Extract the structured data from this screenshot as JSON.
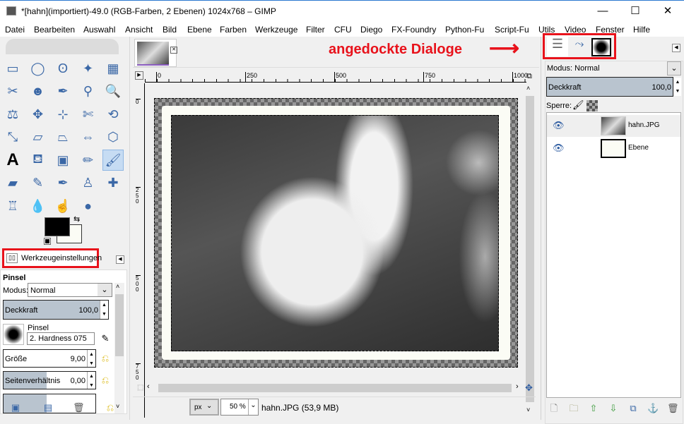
{
  "window": {
    "title": "*[hahn](importiert)-49.0 (RGB-Farben, 2 Ebenen) 1024x768 – GIMP",
    "minimize": "—",
    "maximize": "☐",
    "close": "✕"
  },
  "menu": [
    "Datei",
    "Bearbeiten",
    "Auswahl",
    "Ansicht",
    "Bild",
    "Ebene",
    "Farben",
    "Werkzeuge",
    "Filter",
    "CFU",
    "Diego",
    "FX-Foundry",
    "Python-Fu",
    "Script-Fu",
    "Utils",
    "Video",
    "Fenster",
    "Hilfe"
  ],
  "tools": [
    {
      "name": "rect-select",
      "g": "▭"
    },
    {
      "name": "ellipse-select",
      "g": "◯"
    },
    {
      "name": "free-select",
      "g": "ʘ"
    },
    {
      "name": "fuzzy-select",
      "g": "✦"
    },
    {
      "name": "select-by-color",
      "g": "▦"
    },
    {
      "name": "scissors",
      "g": "✂"
    },
    {
      "name": "foreground-select",
      "g": "☻"
    },
    {
      "name": "paths",
      "g": "✒"
    },
    {
      "name": "color-picker",
      "g": "⚲"
    },
    {
      "name": "zoom",
      "g": "🔍"
    },
    {
      "name": "measure",
      "g": "⚖"
    },
    {
      "name": "move",
      "g": "✥"
    },
    {
      "name": "align",
      "g": "⊹"
    },
    {
      "name": "crop",
      "g": "✄"
    },
    {
      "name": "rotate",
      "g": "⟲"
    },
    {
      "name": "scale",
      "g": "⤡"
    },
    {
      "name": "shear",
      "g": "▱"
    },
    {
      "name": "perspective",
      "g": "⏢"
    },
    {
      "name": "flip",
      "g": "⇔"
    },
    {
      "name": "cage-transform",
      "g": "⬡"
    },
    {
      "name": "text",
      "g": "A"
    },
    {
      "name": "bucket-fill",
      "g": "⛾"
    },
    {
      "name": "blend",
      "g": "▣"
    },
    {
      "name": "pencil",
      "g": "✏"
    },
    {
      "name": "paintbrush",
      "g": "🖌"
    },
    {
      "name": "eraser",
      "g": "▰"
    },
    {
      "name": "airbrush",
      "g": "✎"
    },
    {
      "name": "ink",
      "g": "✒"
    },
    {
      "name": "clone",
      "g": "♙"
    },
    {
      "name": "heal",
      "g": "✚"
    },
    {
      "name": "perspective-clone",
      "g": "♖"
    },
    {
      "name": "blur",
      "g": "💧"
    },
    {
      "name": "smudge",
      "g": "☝"
    },
    {
      "name": "dodge-burn",
      "g": "●"
    }
  ],
  "colors": {
    "foreground": "#000000",
    "background": "#fbfcf5",
    "accent_red": "#e8121b",
    "slider": "#b9c4cf"
  },
  "tool_options": {
    "tab_label": "Werkzeugeinstellungen",
    "tool_name": "Pinsel",
    "mode_label": "Modus:",
    "mode_value": "Normal",
    "opacity_label": "Deckkraft",
    "opacity_value": "100,0",
    "brush_label": "Pinsel",
    "brush_value": "2. Hardness 075",
    "size_label": "Größe",
    "size_value": "9,00",
    "aspect_label": "Seitenverhältnis",
    "aspect_value": "0,00"
  },
  "image_window": {
    "tab_thumb": "hahn",
    "ruler_h": [
      "0",
      "250",
      "500",
      "750",
      "1000"
    ],
    "ruler_v": [
      "0",
      "250",
      "500",
      "750"
    ],
    "unit": "px",
    "zoom": "50 %",
    "status": "hahn.JPG (53,9 MB)"
  },
  "annotation": {
    "text": "angedockte Dialoge",
    "arrow": "⟶"
  },
  "dock": {
    "tabs": [
      "layers-icon",
      "paths-icon",
      "brushes-icon"
    ],
    "mode_label": "Modus:",
    "mode_value": "Normal",
    "opacity_label": "Deckkraft",
    "opacity_value": "100,0",
    "lock_label": "Sperre:",
    "layers": [
      {
        "name": "hahn.JPG",
        "visible": true,
        "selected": true
      },
      {
        "name": "Ebene",
        "visible": true,
        "selected": false
      }
    ]
  }
}
